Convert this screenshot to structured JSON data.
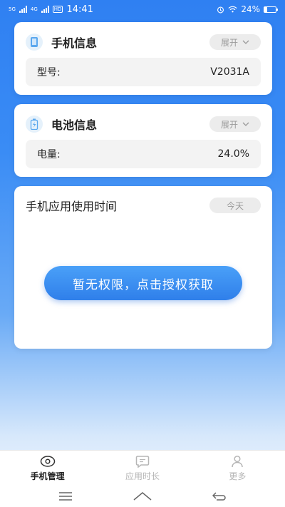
{
  "status_bar": {
    "sig1_label": "5G",
    "sig2_label": "4G",
    "hd_label": "HD",
    "time": "14:41",
    "battery_text": "24%",
    "battery_level_pct": 24
  },
  "phone_info": {
    "title": "手机信息",
    "toggle_label": "展开",
    "row_label": "型号:",
    "row_value": "V2031A"
  },
  "battery_info": {
    "title": "电池信息",
    "toggle_label": "展开",
    "row_label": "电量:",
    "row_value": "24.0%"
  },
  "usage": {
    "title": "手机应用使用时间",
    "filter_label": "今天",
    "grant_button_label": "暂无权限，点击授权获取"
  },
  "bottom_nav": {
    "items": [
      {
        "label": "手机管理",
        "icon": "eye-icon"
      },
      {
        "label": "应用时长",
        "icon": "message-icon"
      },
      {
        "label": "更多",
        "icon": "user-icon"
      }
    ],
    "active_index": 0
  },
  "colors": {
    "accent": "#2f80f2",
    "active_text": "#222222",
    "inactive_text": "#b5b5b5"
  }
}
